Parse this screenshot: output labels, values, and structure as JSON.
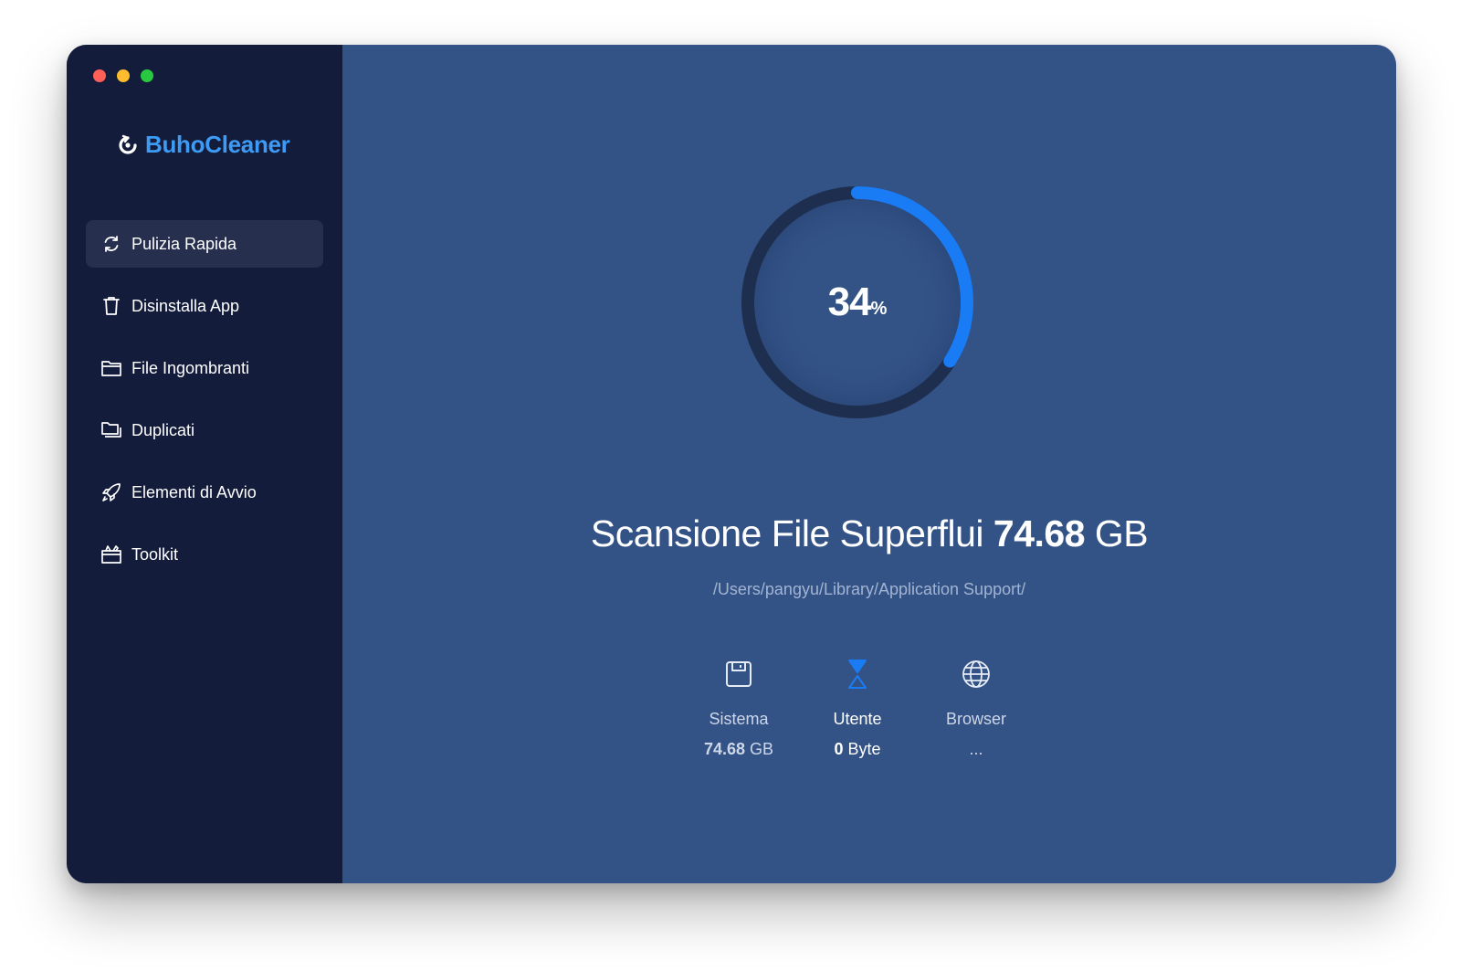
{
  "app": {
    "name": "BuhoCleaner",
    "brand_color": "#3d9bf5"
  },
  "window_controls": [
    "close",
    "minimize",
    "zoom"
  ],
  "sidebar": {
    "items": [
      {
        "label": "Pulizia Rapida",
        "icon": "refresh-icon",
        "active": true
      },
      {
        "label": "Disinstalla App",
        "icon": "trash-icon",
        "active": false
      },
      {
        "label": "File Ingombranti",
        "icon": "folder-icon",
        "active": false
      },
      {
        "label": "Duplicati",
        "icon": "duplicate-folder-icon",
        "active": false
      },
      {
        "label": "Elementi di Avvio",
        "icon": "rocket-icon",
        "active": false
      },
      {
        "label": "Toolkit",
        "icon": "toolbox-icon",
        "active": false
      }
    ]
  },
  "scan": {
    "progress": 34,
    "progress_unit": "%",
    "headline_prefix": "Scansione File Superflui",
    "total_size_value": "74.68",
    "total_size_unit": "GB",
    "current_path": "/Users/pangyu/Library/Application Support/",
    "progress_color": "#1a7cf5",
    "track_color": "#1e2e4f"
  },
  "categories": [
    {
      "label": "Sistema",
      "value": "74.68",
      "unit": "GB",
      "icon": "disk-icon",
      "active": false
    },
    {
      "label": "Utente",
      "value": "0",
      "unit": "Byte",
      "icon": "hourglass-icon",
      "active": true
    },
    {
      "label": "Browser",
      "value": "...",
      "unit": "",
      "icon": "globe-icon",
      "active": false
    }
  ]
}
